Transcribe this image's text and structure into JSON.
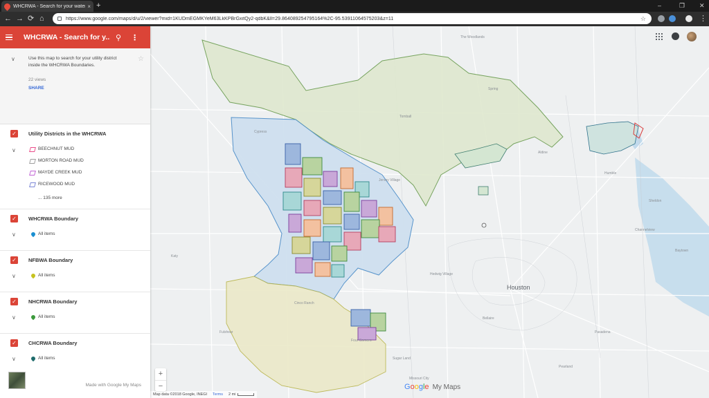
{
  "browser": {
    "tab_title": "WHCRWA - Search for your water",
    "tab_close": "×",
    "new_tab": "+",
    "url": "https://www.google.com/maps/d/u/2/viewer?mid=1KUDmEGMKYeM63LkKPBrGxitQy2-qdbK&ll=29.86408925479516​4%2C-95.53911064575203&z=11",
    "window_controls": [
      "–",
      "❐",
      "✕"
    ],
    "nav": [
      "←",
      "→",
      "⟳",
      "⌂"
    ],
    "menu": "⋮",
    "bookmark_star": "☆"
  },
  "panel": {
    "title": "WHCRWA - Search for y...",
    "description": "Use this map to search for your utility district inside the WHCRWA Boundaries.",
    "views": "22 views",
    "share": "SHARE",
    "layers": [
      {
        "name": "Utility Districts in the WHCRWA",
        "items": [
          "BEECHNUT MUD",
          "MORTON ROAD MUD",
          "MAYDE CREEK MUD",
          "RICEWOOD MUD"
        ],
        "item_colors": [
          "#ea4c89",
          "#9e9e9e",
          "#c264d6",
          "#7b86d6"
        ],
        "more": "... 135 more"
      },
      {
        "name": "WHCRWA Boundary",
        "item": "All items",
        "pin_color": "#1a8fd1"
      },
      {
        "name": "NFBWA Boundary",
        "item": "All items",
        "pin_color": "#c6c21f"
      },
      {
        "name": "NHCRWA Boundary",
        "item": "All items",
        "pin_color": "#3c9a3c"
      },
      {
        "name": "CHCRWA Boundary",
        "item": "All items",
        "pin_color": "#1e6b6b"
      }
    ],
    "made_with": "Made with Google My Maps"
  },
  "map": {
    "city_label": "Houston",
    "google_logo": [
      "G",
      "o",
      "o",
      "g",
      "l",
      "e"
    ],
    "my_maps": "My Maps",
    "zoom_in": "+",
    "zoom_out": "−",
    "attribution": "Map data ©2018 Google, INEGI",
    "terms": "Terms",
    "scale": "2 mi",
    "place_labels": [
      "The Woodlands",
      "Spring",
      "Tomball",
      "Cypress",
      "Katy",
      "Fulshear",
      "Sugar Land",
      "Pasadena",
      "Missouri City",
      "Humble",
      "Baytown",
      "Pearland",
      "Bellaire",
      "Jersey Village",
      "Hedwig Village",
      "Cinco Ranch",
      "Four Corners",
      "Sheldon",
      "Channelview",
      "Aldine"
    ],
    "colors": {
      "north_fill": "#dfe8cf",
      "north_stroke": "#6a9b4f",
      "west_fill": "#cfe0ef",
      "west_stroke": "#4f8fc9",
      "south_fill": "#ebe9c8",
      "south_stroke": "#b8b44a",
      "road": "#ffffff",
      "major_road": "#f6f6f6",
      "water": "#a9cde8"
    }
  }
}
